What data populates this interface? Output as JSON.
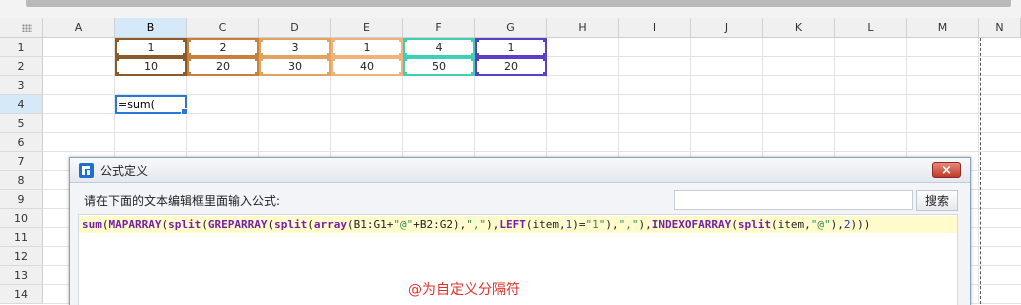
{
  "columns": [
    "A",
    "B",
    "C",
    "D",
    "E",
    "F",
    "G",
    "H",
    "I",
    "J",
    "K",
    "L",
    "M",
    "N"
  ],
  "rows": [
    "1",
    "2",
    "3",
    "4",
    "5",
    "6",
    "7",
    "8",
    "9",
    "10",
    "11",
    "12",
    "13",
    "14"
  ],
  "row1_values": [
    "1",
    "2",
    "3",
    "1",
    "4",
    "1"
  ],
  "row2_values": [
    "10",
    "20",
    "30",
    "40",
    "50",
    "20"
  ],
  "active_cell_text": "=sum(",
  "dialog": {
    "title": "公式定义",
    "close_label": "×",
    "prompt": "请在下面的文本编辑框里面输入公式:",
    "search_value": "",
    "search_button": "搜索",
    "formula_tokens": [
      {
        "t": "sum",
        "k": "fn"
      },
      {
        "t": "(",
        "k": "pun"
      },
      {
        "t": "MAPARRAY",
        "k": "fn"
      },
      {
        "t": "(",
        "k": "pun"
      },
      {
        "t": "split",
        "k": "fn"
      },
      {
        "t": "(",
        "k": "pun"
      },
      {
        "t": "GREPARRAY",
        "k": "fn"
      },
      {
        "t": "(",
        "k": "pun"
      },
      {
        "t": "split",
        "k": "fn"
      },
      {
        "t": "(",
        "k": "pun"
      },
      {
        "t": "array",
        "k": "fn"
      },
      {
        "t": "(",
        "k": "pun"
      },
      {
        "t": "B1:G1",
        "k": "ref"
      },
      {
        "t": "+",
        "k": "pun"
      },
      {
        "t": "\"@\"",
        "k": "str"
      },
      {
        "t": "+",
        "k": "pun"
      },
      {
        "t": "B2:G2",
        "k": "ref"
      },
      {
        "t": "),",
        "k": "pun"
      },
      {
        "t": "\",\"",
        "k": "str"
      },
      {
        "t": "),",
        "k": "pun"
      },
      {
        "t": "LEFT",
        "k": "fn"
      },
      {
        "t": "(",
        "k": "pun"
      },
      {
        "t": "item",
        "k": "ref"
      },
      {
        "t": ",",
        "k": "pun"
      },
      {
        "t": "1",
        "k": "num"
      },
      {
        "t": ")=",
        "k": "pun"
      },
      {
        "t": "\"1\"",
        "k": "str"
      },
      {
        "t": "),",
        "k": "pun"
      },
      {
        "t": "\",\"",
        "k": "str"
      },
      {
        "t": "),",
        "k": "pun"
      },
      {
        "t": "INDEXOFARRAY",
        "k": "fn"
      },
      {
        "t": "(",
        "k": "pun"
      },
      {
        "t": "split",
        "k": "fn"
      },
      {
        "t": "(",
        "k": "pun"
      },
      {
        "t": "item",
        "k": "ref"
      },
      {
        "t": ",",
        "k": "pun"
      },
      {
        "t": "\"@\"",
        "k": "str"
      },
      {
        "t": "),",
        "k": "pun"
      },
      {
        "t": "2",
        "k": "num"
      },
      {
        "t": ")))",
        "k": "pun"
      }
    ],
    "annotation": "@为自定义分隔符"
  },
  "colors": {
    "selection_blue": "#2a78d4",
    "header_selected": "#d6e9f8",
    "function_color": "#7a1fa2",
    "string_color": "#2e8b57",
    "number_color": "#1a3fbf",
    "annotation_color": "#e0312b",
    "formula_highlight": "#fffbcc",
    "range_colors": [
      "#8b5a2b",
      "#c8813c",
      "#e3a35f",
      "#f0b27a",
      "#3fcfb6",
      "#5b3fc8"
    ]
  }
}
